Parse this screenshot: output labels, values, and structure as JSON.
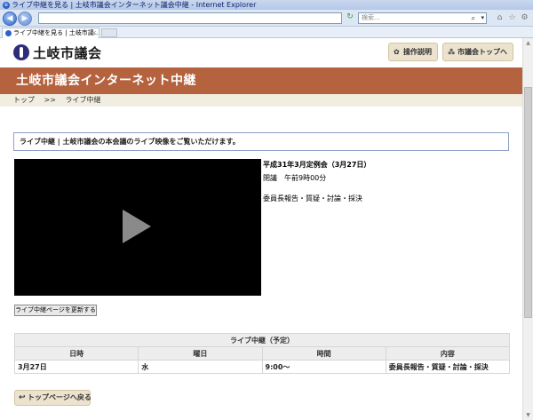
{
  "window": {
    "title": "ライブ中継を見る | 土岐市議会インターネット議会中継 - Internet Explorer"
  },
  "browser": {
    "address_value": "",
    "search_placeholder": "検索...",
    "tab_label": "ライブ中継を見る | 土岐市議...",
    "icons": [
      "back-icon",
      "forward-icon",
      "refresh-icon",
      "search-icon",
      "home-icon",
      "favorites-icon",
      "tools-icon"
    ]
  },
  "header": {
    "site_name": "土岐市議会",
    "guide_button": "操作説明",
    "top_button": "市議会トップへ"
  },
  "banner": {
    "title": "土岐市議会インターネット中継"
  },
  "breadcrumb": {
    "home": "トップ",
    "separator": ">>",
    "current": "ライブ中継"
  },
  "info": {
    "text": "ライブ中継 | 土岐市議会の本会議のライブ映像をご覧いただけます。"
  },
  "session": {
    "title": "平成31年3月定例会（3月27日）",
    "time": "閉議　午前9時00分",
    "agenda": "委員長報告・質疑・討論・採決"
  },
  "refresh_button": "ライブ中継ページを更新する",
  "schedule": {
    "caption": "ライブ中継（予定）",
    "headers": [
      "日時",
      "曜日",
      "時間",
      "内容"
    ],
    "rows": [
      [
        "3月27日",
        "水",
        "9:00～",
        "委員長報告・質疑・討論・採決"
      ]
    ]
  },
  "back_button": "トップページへ戻る"
}
